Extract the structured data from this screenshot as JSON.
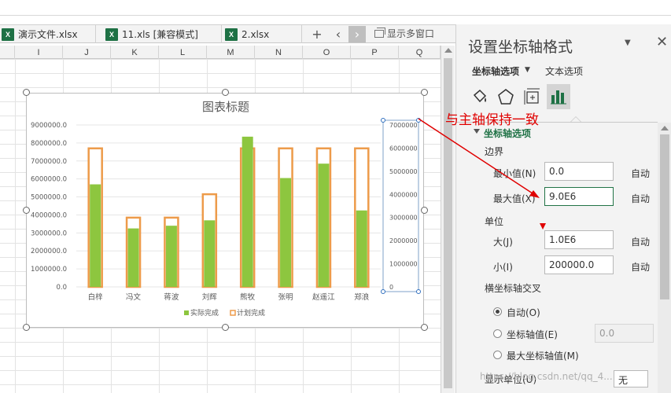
{
  "tabs": [
    {
      "label": "演示文件.xlsx",
      "icon": "X"
    },
    {
      "label": "11.xls  [兼容模式]",
      "icon": "X"
    },
    {
      "label": "2.xlsx",
      "icon": "X"
    }
  ],
  "tabbar": {
    "add": "+",
    "prev": "‹",
    "next": "›",
    "multi_window": "显示多窗口"
  },
  "columns": [
    "I",
    "J",
    "K",
    "L",
    "M",
    "N",
    "O",
    "P",
    "Q"
  ],
  "annotation": "与主轴保持一致",
  "pane": {
    "title": "设置坐标轴格式",
    "tab_axis": "坐标轴选项",
    "tab_text": "文本选项",
    "section": "坐标轴选项",
    "bounds_label": "边界",
    "min_label": "最小值(N)",
    "min_value": "0.0",
    "max_label": "最大值(X)",
    "max_value": "9.0E6",
    "auto": "自动",
    "units_label": "单位",
    "major_label": "大(J)",
    "major_value": "1.0E6",
    "minor_label": "小(I)",
    "minor_value": "200000.0",
    "cross_label": "横坐标轴交叉",
    "cross_auto": "自动(O)",
    "cross_value_label": "坐标轴值(E)",
    "cross_value": "0.0",
    "cross_max": "最大坐标轴值(M)",
    "display_units_label": "显示单位(U)",
    "display_units_value": "无"
  },
  "watermark": "https://blog.csdn.net/qq_4...",
  "chart_data": {
    "type": "bar",
    "title": "图表标题",
    "categories": [
      "白梓",
      "冯文",
      "蒋波",
      "刘辉",
      "熊牧",
      "张明",
      "赵遥江",
      "郑浪"
    ],
    "series": [
      {
        "name": "实际完成",
        "values": [
          5700000,
          3250000,
          3400000,
          3700000,
          8350000,
          6050000,
          6850000,
          4250000
        ],
        "color": "#8dc63f"
      },
      {
        "name": "计划完成",
        "values": [
          7700000,
          3850000,
          3850000,
          5150000,
          7700000,
          7700000,
          7700000,
          7700000
        ],
        "color": "#ed9b4a"
      }
    ],
    "y_left": {
      "min": 0,
      "max": 9000000,
      "step": 1000000,
      "ticks": [
        "0.0",
        "1000000.0",
        "2000000.0",
        "3000000.0",
        "4000000.0",
        "5000000.0",
        "6000000.0",
        "7000000.0",
        "8000000.0",
        "9000000.0"
      ]
    },
    "y_right": {
      "min": 0,
      "max": 7000000,
      "step": 1000000,
      "ticks": [
        "0",
        "1000000",
        "2000000",
        "3000000",
        "4000000",
        "5000000",
        "6000000",
        "7000000"
      ]
    },
    "legend": "bottom"
  }
}
